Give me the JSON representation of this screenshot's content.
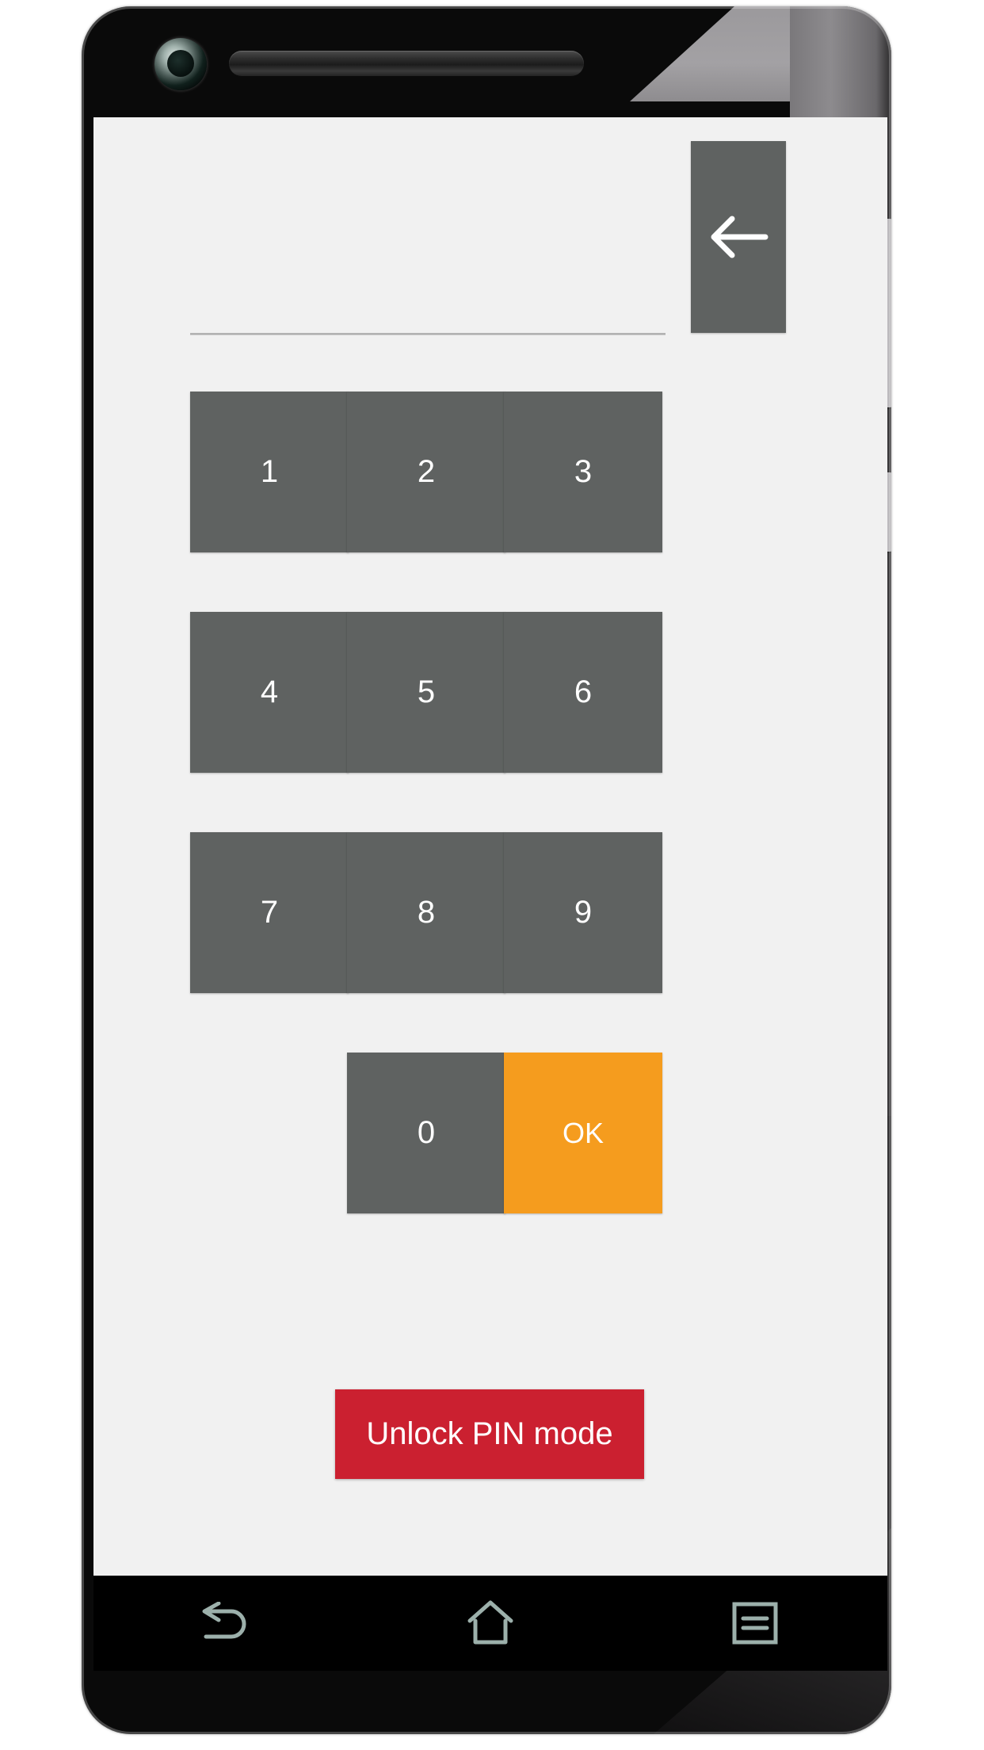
{
  "device": {
    "camera_icon": "front-camera-icon",
    "earpiece_icon": "earpiece-speaker-icon",
    "volume_button": "volume-rocker-button",
    "power_button": "power-button"
  },
  "screen": {
    "background_color": "#f1f1f1",
    "header": {
      "back_button_label": "",
      "back_icon": "arrow-left-icon",
      "back_button_color": "#5f6261"
    },
    "pin_input": {
      "value": "",
      "placeholder": ""
    },
    "keypad": {
      "key_color": "#5f6261",
      "ok_color": "#f59c1e",
      "rows": [
        [
          {
            "label": "1",
            "name": "keypad-key-1",
            "type": "digit"
          },
          {
            "label": "2",
            "name": "keypad-key-2",
            "type": "digit"
          },
          {
            "label": "3",
            "name": "keypad-key-3",
            "type": "digit"
          }
        ],
        [
          {
            "label": "4",
            "name": "keypad-key-4",
            "type": "digit"
          },
          {
            "label": "5",
            "name": "keypad-key-5",
            "type": "digit"
          },
          {
            "label": "6",
            "name": "keypad-key-6",
            "type": "digit"
          }
        ],
        [
          {
            "label": "7",
            "name": "keypad-key-7",
            "type": "digit"
          },
          {
            "label": "8",
            "name": "keypad-key-8",
            "type": "digit"
          },
          {
            "label": "9",
            "name": "keypad-key-9",
            "type": "digit"
          }
        ],
        [
          {
            "label": "",
            "name": "keypad-spacer",
            "type": "spacer"
          },
          {
            "label": "0",
            "name": "keypad-key-0",
            "type": "digit"
          },
          {
            "label": "OK",
            "name": "keypad-key-ok",
            "type": "ok"
          }
        ]
      ]
    },
    "unlock": {
      "label": "Unlock PIN mode",
      "color": "#cb2030"
    }
  },
  "nav_bar": {
    "background_color": "#000000",
    "items": [
      {
        "name": "nav-back-icon",
        "label": "Back"
      },
      {
        "name": "nav-home-icon",
        "label": "Home"
      },
      {
        "name": "nav-recents-icon",
        "label": "Recents"
      }
    ]
  }
}
